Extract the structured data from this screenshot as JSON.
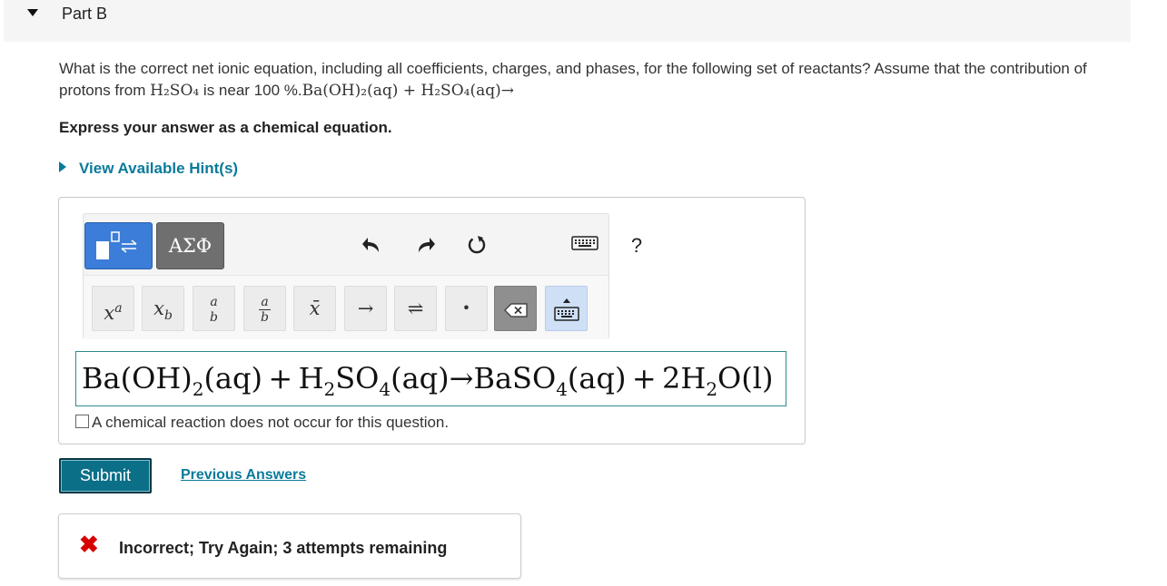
{
  "part": {
    "title": "Part B"
  },
  "question": {
    "text_1": "What is the correct net ionic equation, including all coefficients, charges, and phases, for the following set of reactants? Assume that the contribution of protons from ",
    "h2so4": "H₂SO₄",
    "text_2": " is near 100 %.",
    "reactants": "Ba(OH)₂(aq) + H₂SO₄(aq)→"
  },
  "instruction": "Express your answer as a chemical equation.",
  "hints_label": "View Available Hint(s)",
  "toolbar": {
    "greek_label": "ΑΣΦ",
    "help_label": "?",
    "row2": {
      "superscript": "x",
      "superscript_exp": "a",
      "subscript": "x",
      "subscript_sub": "b",
      "ab_num": "a",
      "ab_den": "b",
      "frac_num": "a",
      "frac_den": "b",
      "mean": "x̄",
      "arrow": "→",
      "equilibrium": "⇌",
      "dot": "•"
    }
  },
  "answer": {
    "p1": "Ba(OH)",
    "s1": "2",
    "p2": "(aq) + H",
    "s2": "2",
    "p3": "SO",
    "s3": "4",
    "p4": "(aq)→BaSO",
    "s4": "4",
    "p5": "(aq) + 2H",
    "s5": "2",
    "p6": "O(l)"
  },
  "no_reaction_label": "A chemical reaction does not occur for this question.",
  "submit_label": "Submit",
  "previous_answers_label": "Previous Answers",
  "feedback": {
    "message": "Incorrect; Try Again; 3 attempts remaining"
  },
  "colors": {
    "link": "#0a7a9b",
    "submit": "#0b6f88",
    "error": "#d60000",
    "templates_active": "#3b7dd8"
  }
}
